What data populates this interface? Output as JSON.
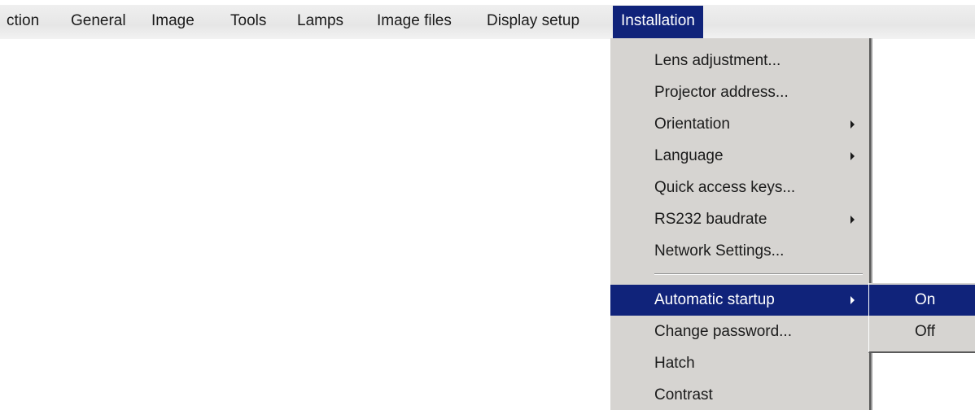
{
  "menubar": {
    "items": [
      {
        "label": "ction"
      },
      {
        "label": "General"
      },
      {
        "label": "Image"
      },
      {
        "label": "Tools"
      },
      {
        "label": "Lamps"
      },
      {
        "label": "Image files"
      },
      {
        "label": "Display setup"
      },
      {
        "label": "Installation",
        "active": true
      }
    ]
  },
  "installation_menu": {
    "items": [
      {
        "label": "Lens adjustment...",
        "submenu": false
      },
      {
        "label": "Projector address...",
        "submenu": false
      },
      {
        "label": "Orientation",
        "submenu": true
      },
      {
        "label": "Language",
        "submenu": true
      },
      {
        "label": "Quick access keys...",
        "submenu": false
      },
      {
        "label": "RS232 baudrate",
        "submenu": true
      },
      {
        "label": "Network Settings...",
        "submenu": false
      },
      {
        "label": "Automatic startup",
        "submenu": true,
        "selected": true
      },
      {
        "label": "Change password...",
        "submenu": false
      },
      {
        "label": "Hatch",
        "submenu": false
      },
      {
        "label": "Contrast",
        "submenu": false
      }
    ]
  },
  "automatic_startup_submenu": {
    "items": [
      {
        "label": "On",
        "selected": true
      },
      {
        "label": "Off"
      }
    ]
  },
  "colors": {
    "highlight": "#10237a",
    "menu_background": "#d6d4d1",
    "highlight_text": "#ffffff"
  }
}
